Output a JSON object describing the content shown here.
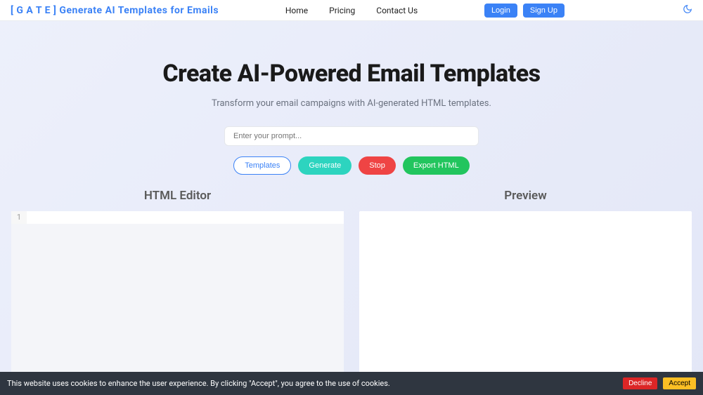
{
  "brand": "[ G A T E ] Generate AI Templates for Emails",
  "nav": {
    "home": "Home",
    "pricing": "Pricing",
    "contact": "Contact Us",
    "login": "Login",
    "signup": "Sign Up"
  },
  "hero": {
    "title": "Create AI-Powered Email Templates",
    "subtitle": "Transform your email campaigns with AI-generated HTML templates.",
    "placeholder": "Enter your prompt..."
  },
  "actions": {
    "templates": "Templates",
    "generate": "Generate",
    "stop": "Stop",
    "export": "Export HTML"
  },
  "panels": {
    "editor": "HTML Editor",
    "preview": "Preview",
    "line1": "1"
  },
  "cookie": {
    "text": "This website uses cookies to enhance the user experience. By clicking \"Accept\", you agree to the use of cookies.",
    "decline": "Decline",
    "accept": "Accept"
  }
}
